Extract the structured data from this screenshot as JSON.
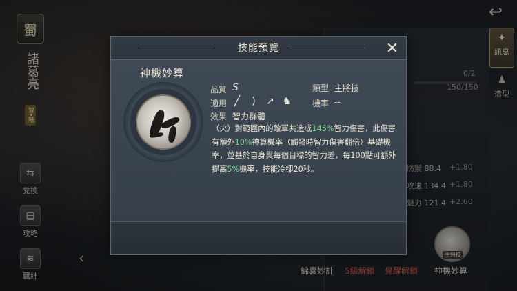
{
  "left": {
    "faction": "蜀",
    "hero_name": "諸葛亮",
    "hero_tag": "智•輔",
    "side_buttons": [
      {
        "label": "兌換"
      },
      {
        "label": "攻略"
      },
      {
        "label": "羈絆"
      }
    ]
  },
  "right": {
    "tab_info": "訊息",
    "tab_appearance": "造型",
    "progress_count": "0/2",
    "hp": "150/150",
    "stats": [
      {
        "name": "防禦",
        "value": "88.4",
        "bonus": "+1.80"
      },
      {
        "name": "攻速",
        "value": "134.4",
        "bonus": "+1.80"
      },
      {
        "name": "魅力",
        "value": "121.4",
        "bonus": "+2.60"
      }
    ],
    "skill_circle_tag": "主將技"
  },
  "bottom": {
    "skill1": "錦囊妙計",
    "skill2": "5級解鎖",
    "skill3": "覺醒解鎖",
    "skill4": "神機妙算"
  },
  "modal": {
    "title": "技能預覽",
    "skill_name": "神機妙算",
    "quality_label": "品質",
    "quality_value": "S",
    "type_label": "類型",
    "type_value": "主將技",
    "applicable_label": "適用",
    "rate_label": "機率",
    "rate_value": "--",
    "effect_label": "效果",
    "effect_value": "智力群體",
    "desc_parts": {
      "p1": "（火）對範圍內的敵軍共造成",
      "g1": "145%",
      "p2": "智力傷害，此傷害有額外",
      "g2": "10%",
      "p3": "神算機率（觸發時智力傷害翻倍）基礎機率，並基於自身與每個目標的智力差，每100點可額外提高",
      "g3": "5%",
      "p4": "機率，技能冷卻20秒。"
    },
    "weapon_icons": [
      "sword-icon",
      "bow-icon",
      "spear-icon",
      "horse-icon"
    ]
  }
}
